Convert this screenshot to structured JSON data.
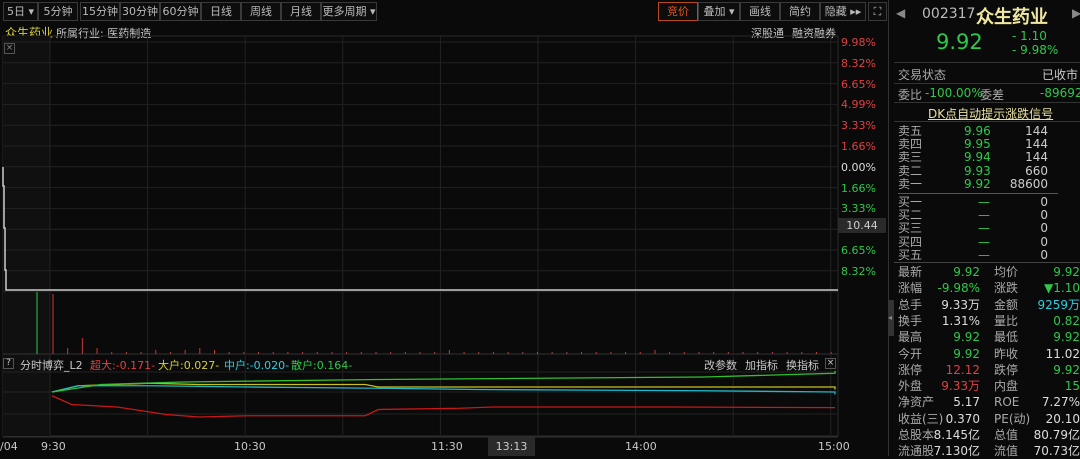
{
  "toolbar": {
    "periods": [
      {
        "label": "5日 ▾"
      },
      {
        "label": "5分钟"
      },
      {
        "label": "15分钟"
      },
      {
        "label": "30分钟"
      },
      {
        "label": "60分钟"
      },
      {
        "label": "日线"
      },
      {
        "label": "周线"
      },
      {
        "label": "月线"
      },
      {
        "label": "更多周期 ▾"
      }
    ],
    "right": [
      {
        "label": "竞价"
      },
      {
        "label": "叠加 ▾"
      },
      {
        "label": "画线"
      },
      {
        "label": "简约"
      },
      {
        "label": "隐藏 ▸▸"
      }
    ]
  },
  "subheader": {
    "stock": "众生药业",
    "industry": "所属行业: 医药制造",
    "tags": [
      "深股通",
      "融资融券"
    ]
  },
  "price_axis": [
    {
      "label": "9.98%",
      "c": "red"
    },
    {
      "label": "8.32%",
      "c": "red"
    },
    {
      "label": "6.65%",
      "c": "red"
    },
    {
      "label": "4.99%",
      "c": "red"
    },
    {
      "label": "3.33%",
      "c": "red"
    },
    {
      "label": "1.66%",
      "c": "red"
    },
    {
      "label": "0.00%",
      "c": "white"
    },
    {
      "label": "1.66%",
      "c": "green"
    },
    {
      "label": "3.33%",
      "c": "green"
    },
    {
      "label": "4.99%",
      "c": "green"
    },
    {
      "label": "6.65%",
      "c": "green"
    },
    {
      "label": "8.32%",
      "c": "green"
    }
  ],
  "cursor_price": "10.44",
  "indicator": {
    "name": "分时博弈_L2",
    "super": "超大:-0.171-",
    "big": "大户:0.027-",
    "mid": "中户:-0.020-",
    "retail": "散户:0.164-",
    "buttons": [
      "改参数",
      "加指标",
      "换指标"
    ]
  },
  "time_axis": {
    "left": "/04",
    "labels": [
      "9:30",
      "10:30",
      "11:30",
      "14:00",
      "15:00"
    ],
    "cursor": "13:13"
  },
  "chart_data": {
    "type": "line",
    "prev_close": 11.02,
    "price": 9.92,
    "volume": [
      30,
      3,
      8,
      3,
      1,
      1,
      1,
      2,
      1,
      2,
      3,
      2,
      1,
      1,
      1,
      1,
      1,
      1,
      1,
      1,
      1,
      1,
      1,
      1,
      1,
      1,
      1,
      2,
      1,
      1,
      1,
      1,
      1,
      1,
      1,
      1,
      1,
      1,
      1,
      1,
      1,
      2,
      1,
      1,
      1,
      1,
      1,
      1,
      1,
      1,
      1,
      1,
      1,
      1,
      1,
      1,
      1,
      1,
      1,
      1,
      5,
      1,
      1,
      1,
      1,
      1,
      1,
      1,
      1,
      1,
      1,
      2,
      1,
      1,
      1,
      1,
      1,
      1,
      1,
      1
    ],
    "series": [
      {
        "name": "超大",
        "color": "#c81818",
        "points": [
          [
            0,
            -0.03
          ],
          [
            6,
            -0.1
          ],
          [
            20,
            -0.12
          ],
          [
            35,
            -0.18
          ],
          [
            45,
            -0.2
          ],
          [
            60,
            -0.19
          ],
          [
            96,
            -0.19
          ],
          [
            100,
            -0.14
          ],
          [
            125,
            -0.13
          ],
          [
            135,
            -0.12
          ],
          [
            190,
            -0.12
          ],
          [
            240,
            -0.125
          ]
        ]
      },
      {
        "name": "大户",
        "color": "#c8c020",
        "points": [
          [
            0,
            0
          ],
          [
            8,
            0.05
          ],
          [
            30,
            0.07
          ],
          [
            45,
            0.06
          ],
          [
            96,
            0.06
          ],
          [
            100,
            0.04
          ],
          [
            240,
            0.04
          ],
          [
            480,
            0.02
          ]
        ]
      },
      {
        "name": "中户",
        "color": "#20b8c8",
        "points": [
          [
            0,
            0
          ],
          [
            8,
            0.05
          ],
          [
            30,
            0.05
          ],
          [
            60,
            0.04
          ],
          [
            100,
            0.03
          ],
          [
            130,
            0.02
          ],
          [
            200,
            0.01
          ],
          [
            240,
            0.0
          ],
          [
            480,
            -0.02
          ]
        ]
      },
      {
        "name": "散户",
        "color": "#30c030",
        "points": [
          [
            0,
            0
          ],
          [
            15,
            0.06
          ],
          [
            40,
            0.08
          ],
          [
            100,
            0.1
          ],
          [
            200,
            0.12
          ],
          [
            350,
            0.15
          ],
          [
            480,
            0.17
          ]
        ]
      }
    ]
  },
  "quote": {
    "code": "002317",
    "name": "众生药业",
    "price": "9.92",
    "change": "- 1.10",
    "pct": "- 9.98%",
    "status_label": "交易状态",
    "status": "已收市",
    "wb_label": "委比",
    "wb": "-100.00%",
    "wc_label": "委差",
    "wc": "-89692",
    "signal": "DK点自动提示涨跌信号",
    "asks": [
      {
        "l": "卖五",
        "p": "9.96",
        "v": "144"
      },
      {
        "l": "卖四",
        "p": "9.95",
        "v": "144"
      },
      {
        "l": "卖三",
        "p": "9.94",
        "v": "144"
      },
      {
        "l": "卖二",
        "p": "9.93",
        "v": "660"
      },
      {
        "l": "卖一",
        "p": "9.92",
        "v": "88600"
      }
    ],
    "bids": [
      {
        "l": "买一",
        "p": "—",
        "v": "0"
      },
      {
        "l": "买二",
        "p": "—",
        "v": "0"
      },
      {
        "l": "买三",
        "p": "—",
        "v": "0"
      },
      {
        "l": "买四",
        "p": "—",
        "v": "0"
      },
      {
        "l": "买五",
        "p": "—",
        "v": "0"
      }
    ],
    "stats": [
      {
        "l1": "最新",
        "v1": "9.92",
        "c1": "green",
        "l2": "均价",
        "v2": "9.92",
        "c2": "green"
      },
      {
        "l1": "涨幅",
        "v1": "-9.98%",
        "c1": "green",
        "l2": "涨跌",
        "v2": "▼1.10",
        "c2": "green"
      },
      {
        "l1": "总手",
        "v1": "9.33万",
        "c1": "white",
        "l2": "金额",
        "v2": "9259万",
        "c2": "cyan"
      },
      {
        "l1": "换手",
        "v1": "1.31%",
        "c1": "white",
        "l2": "量比",
        "v2": "0.82",
        "c2": "green"
      },
      {
        "l1": "最高",
        "v1": "9.92",
        "c1": "green",
        "l2": "最低",
        "v2": "9.92",
        "c2": "green"
      },
      {
        "l1": "今开",
        "v1": "9.92",
        "c1": "green",
        "l2": "昨收",
        "v2": "11.02",
        "c2": "white"
      },
      {
        "l1": "涨停",
        "v1": "12.12",
        "c1": "red",
        "l2": "跌停",
        "v2": "9.92",
        "c2": "green"
      },
      {
        "l1": "外盘",
        "v1": "9.33万",
        "c1": "red",
        "l2": "内盘",
        "v2": "15",
        "c2": "green"
      },
      {
        "l1": "净资产",
        "v1": "5.17",
        "c1": "white",
        "l2": "ROE",
        "v2": "7.27%",
        "c2": "white"
      },
      {
        "l1": "收益(三)",
        "v1": "0.370",
        "c1": "white",
        "l2": "PE(动)",
        "v2": "20.10",
        "c2": "white"
      },
      {
        "l1": "总股本",
        "v1": "8.145亿",
        "c1": "white",
        "l2": "总值",
        "v2": "80.79亿",
        "c2": "white"
      },
      {
        "l1": "流通股",
        "v1": "7.130亿",
        "c1": "white",
        "l2": "流值",
        "v2": "70.73亿",
        "c2": "white"
      }
    ]
  },
  "colors": {
    "accent": "#e0561f",
    "up": "#e04040",
    "down": "#2ec84a"
  }
}
